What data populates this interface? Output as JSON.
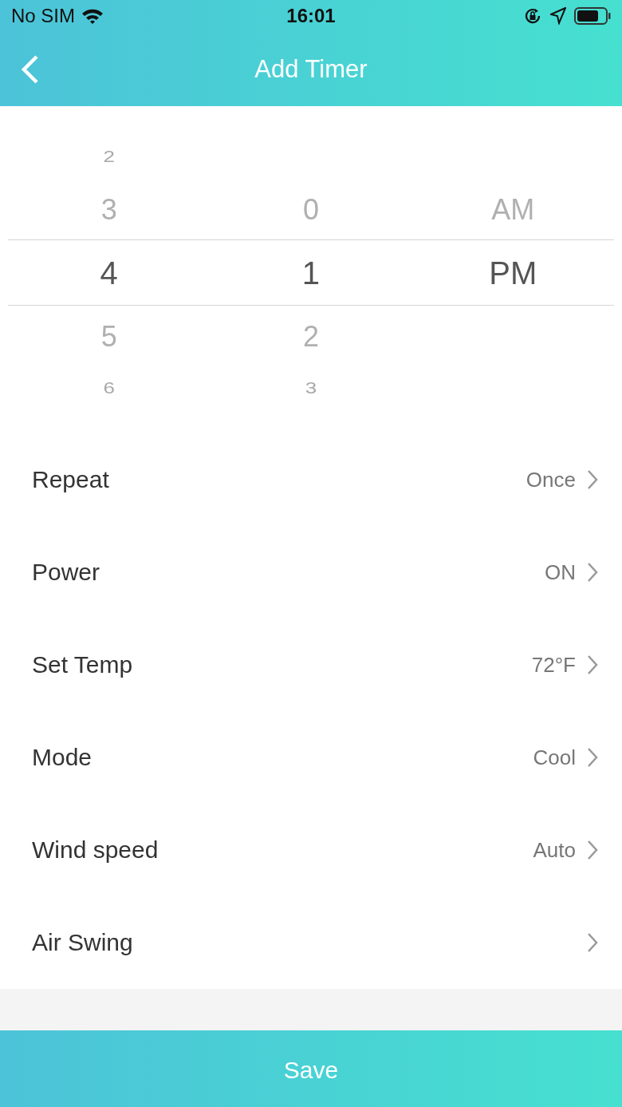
{
  "status_bar": {
    "carrier": "No SIM",
    "time": "16:01"
  },
  "header": {
    "title": "Add Timer"
  },
  "picker": {
    "columns": [
      {
        "items": [
          {
            "label": "2",
            "selected": false
          },
          {
            "label": "3",
            "selected": false
          },
          {
            "label": "4",
            "selected": true
          },
          {
            "label": "5",
            "selected": false
          },
          {
            "label": "6",
            "selected": false
          }
        ]
      },
      {
        "items": [
          {
            "label": "0",
            "selected": false
          },
          {
            "label": "1",
            "selected": true
          },
          {
            "label": "2",
            "selected": false
          },
          {
            "label": "3",
            "selected": false
          }
        ]
      },
      {
        "items": [
          {
            "label": "AM",
            "selected": false
          },
          {
            "label": "PM",
            "selected": true
          }
        ]
      }
    ]
  },
  "settings": [
    {
      "label": "Repeat",
      "value": "Once"
    },
    {
      "label": "Power",
      "value": "ON"
    },
    {
      "label": "Set Temp",
      "value": "72°F"
    },
    {
      "label": "Mode",
      "value": "Cool"
    },
    {
      "label": "Wind speed",
      "value": "Auto"
    },
    {
      "label": "Air Swing"
    }
  ],
  "save_button": {
    "label": "Save"
  }
}
